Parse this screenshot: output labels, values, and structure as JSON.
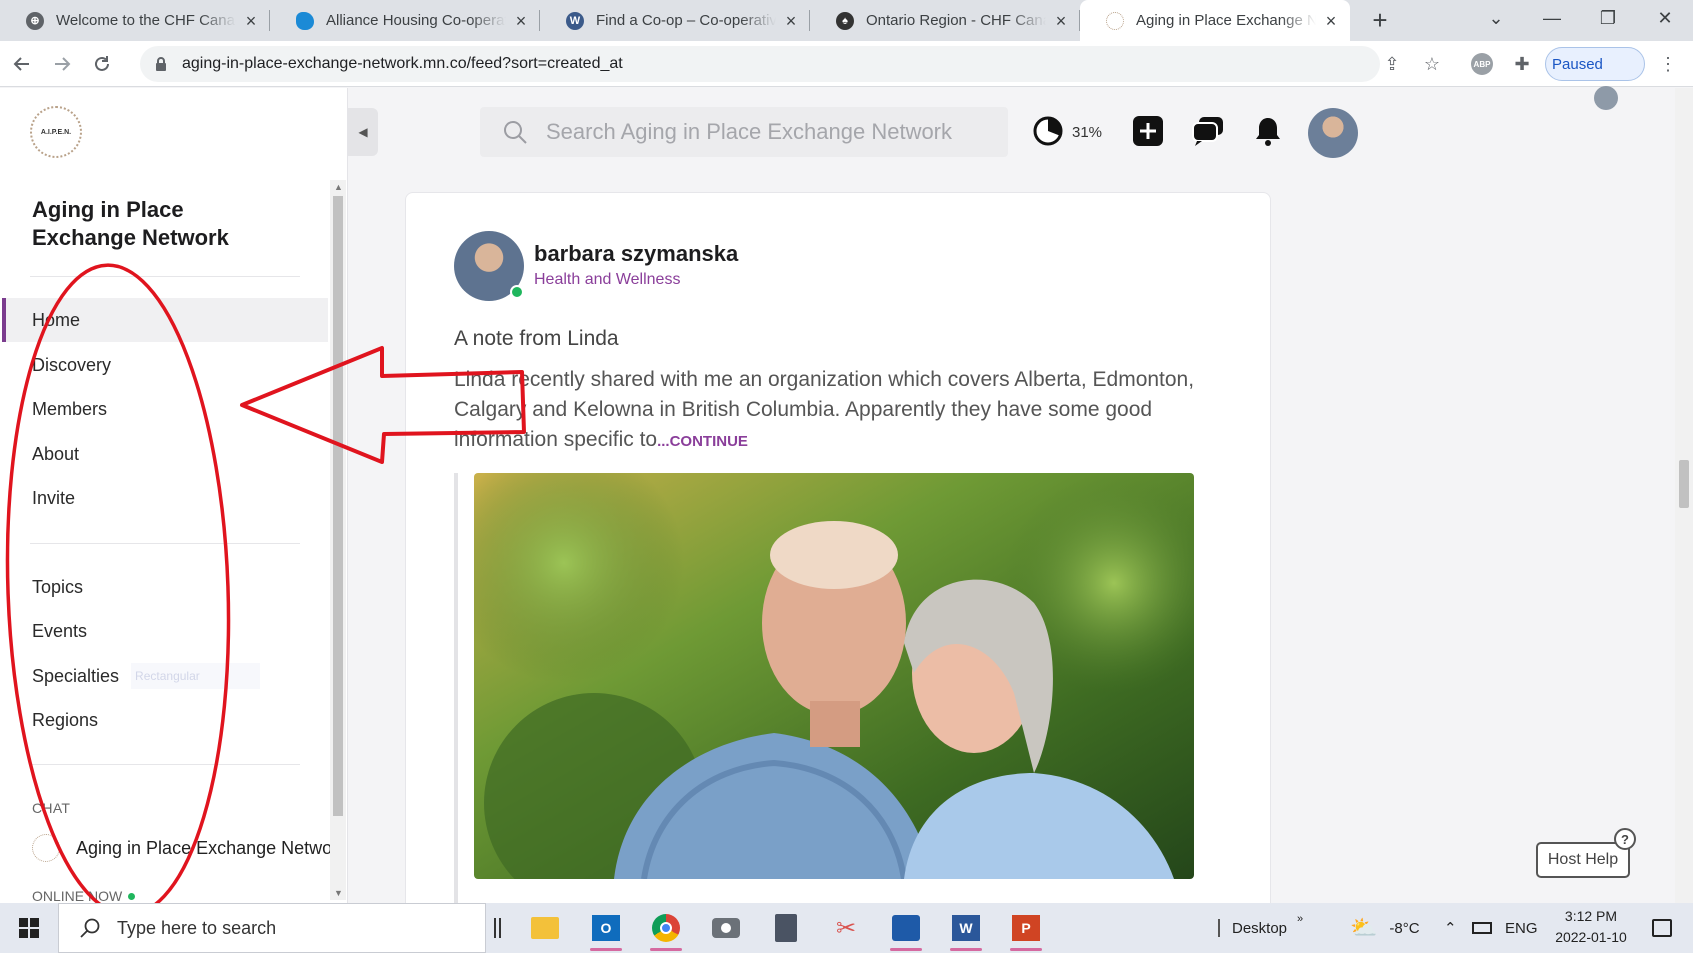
{
  "browser": {
    "tabs": [
      {
        "label": "Welcome to the CHF Canada",
        "favicon_color": "#5f6368"
      },
      {
        "label": "Alliance Housing Co-operative",
        "favicon_color": "#1b8ad6"
      },
      {
        "label": "Find a Co-op – Co-operative",
        "favicon_color": "#3b5a8a"
      },
      {
        "label": "Ontario Region - CHF Canada",
        "favicon_color": "#333333"
      },
      {
        "label": "Aging in Place Exchange Network",
        "favicon_color": "#c7c7c7"
      }
    ],
    "url": "aging-in-place-exchange-network.mn.co/feed?sort=created_at",
    "profile_label": "Paused"
  },
  "sidebar": {
    "logo_text": "A.I.P.E.N.",
    "community_name": "Aging in Place Exchange Network",
    "nav_primary": [
      {
        "label": "Home"
      },
      {
        "label": "Discovery"
      },
      {
        "label": "Members"
      },
      {
        "label": "About"
      },
      {
        "label": "Invite"
      }
    ],
    "nav_secondary": [
      {
        "label": "Topics"
      },
      {
        "label": "Events"
      },
      {
        "label": "Specialties"
      },
      {
        "label": "Regions"
      }
    ],
    "specialties_hint": "Rectangular",
    "chat_heading": "CHAT",
    "chat_item": "Aging in Place Exchange Network",
    "online_label": "ONLINE NOW"
  },
  "header": {
    "search_placeholder": "Search Aging in Place Exchange Network",
    "progress_percent": "31%",
    "progress_value": 0.31
  },
  "post": {
    "author": "barbara szymanska",
    "space": "Health and Wellness",
    "title": "A note from Linda",
    "body": "Linda recently shared with me an organization which covers Alberta, Edmonton, Calgary and Kelowna in British Columbia. Apparently they have some good information specific to",
    "continue": "...CONTINUE"
  },
  "host_help": "Host Help",
  "taskbar": {
    "search_placeholder": "Type here to search",
    "desktop_label": "Desktop",
    "temperature": "-8°C",
    "language": "ENG",
    "time": "3:12 PM",
    "date": "2022-01-10"
  },
  "colors": {
    "accent": "#8a3e9a",
    "annotation": "#e0141e",
    "online": "#1fb65d"
  }
}
